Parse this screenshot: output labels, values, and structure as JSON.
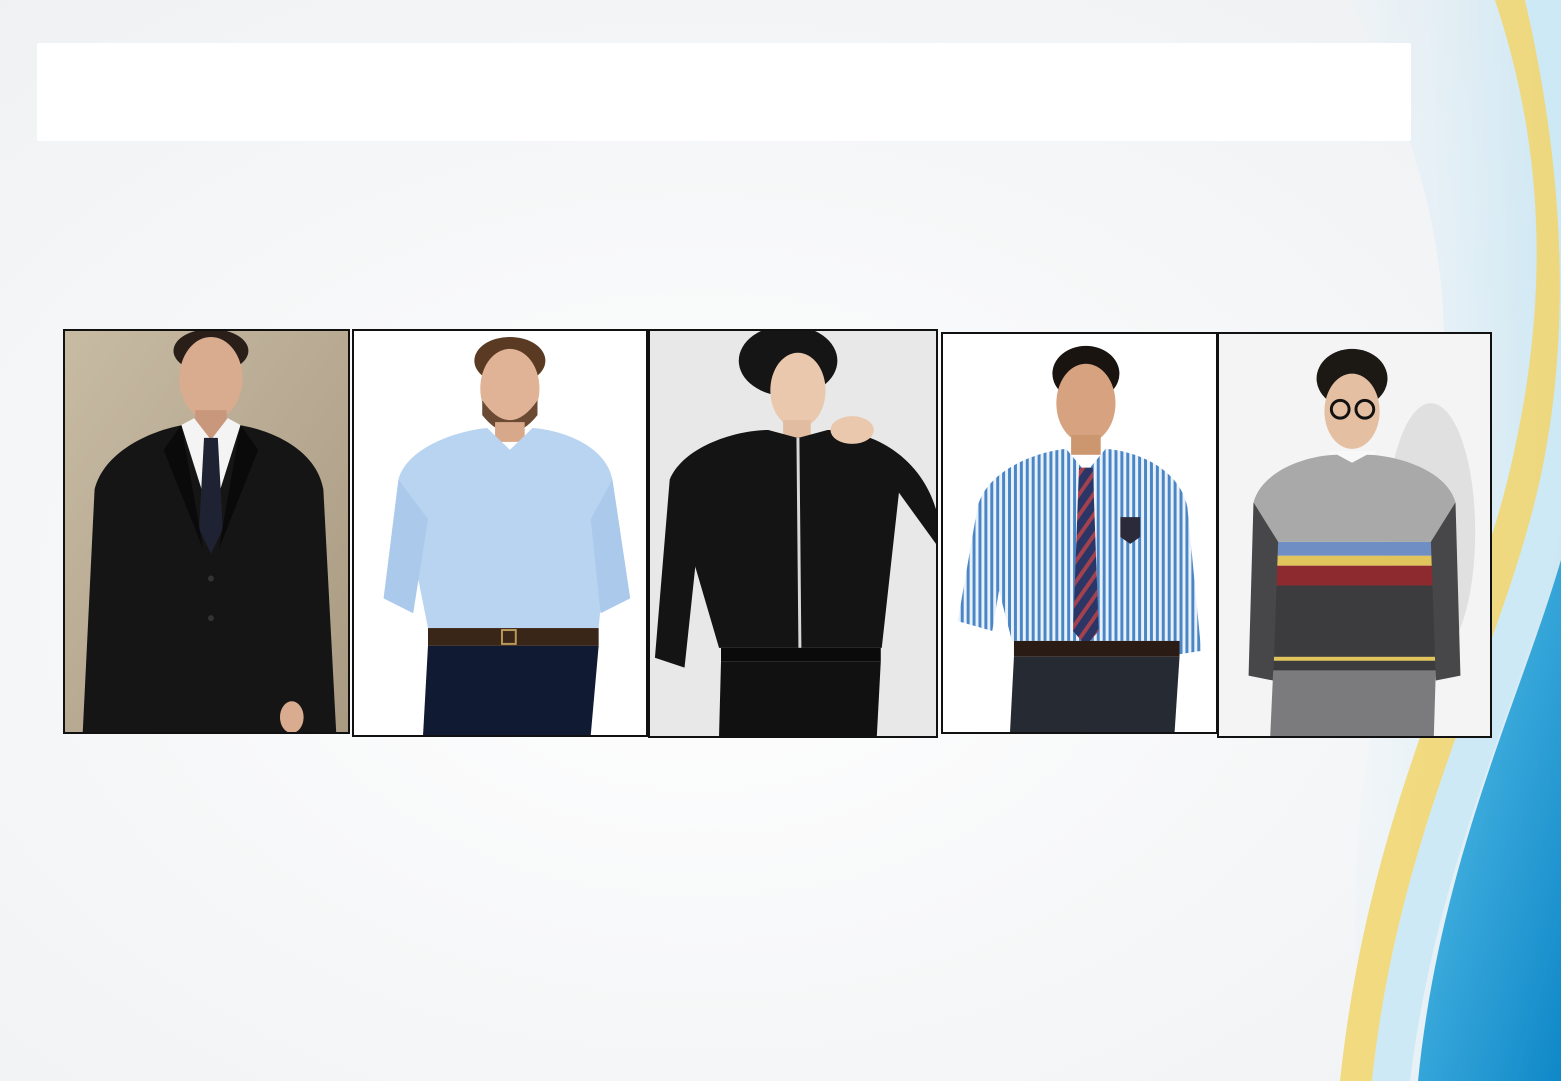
{
  "slide": {
    "title": "",
    "photos": [
      {
        "name": "man-in-black-suit"
      },
      {
        "name": "man-in-light-blue-shirt"
      },
      {
        "name": "man-in-black-shirt"
      },
      {
        "name": "man-in-striped-shirt-and-tie"
      },
      {
        "name": "man-in-patterned-sweater"
      }
    ]
  },
  "theme": {
    "background": "#f4f5f6",
    "wave_blue": "#1aa3d6",
    "wave_light_blue": "#bfe2f2",
    "wave_yellow": "#f2d56b"
  }
}
